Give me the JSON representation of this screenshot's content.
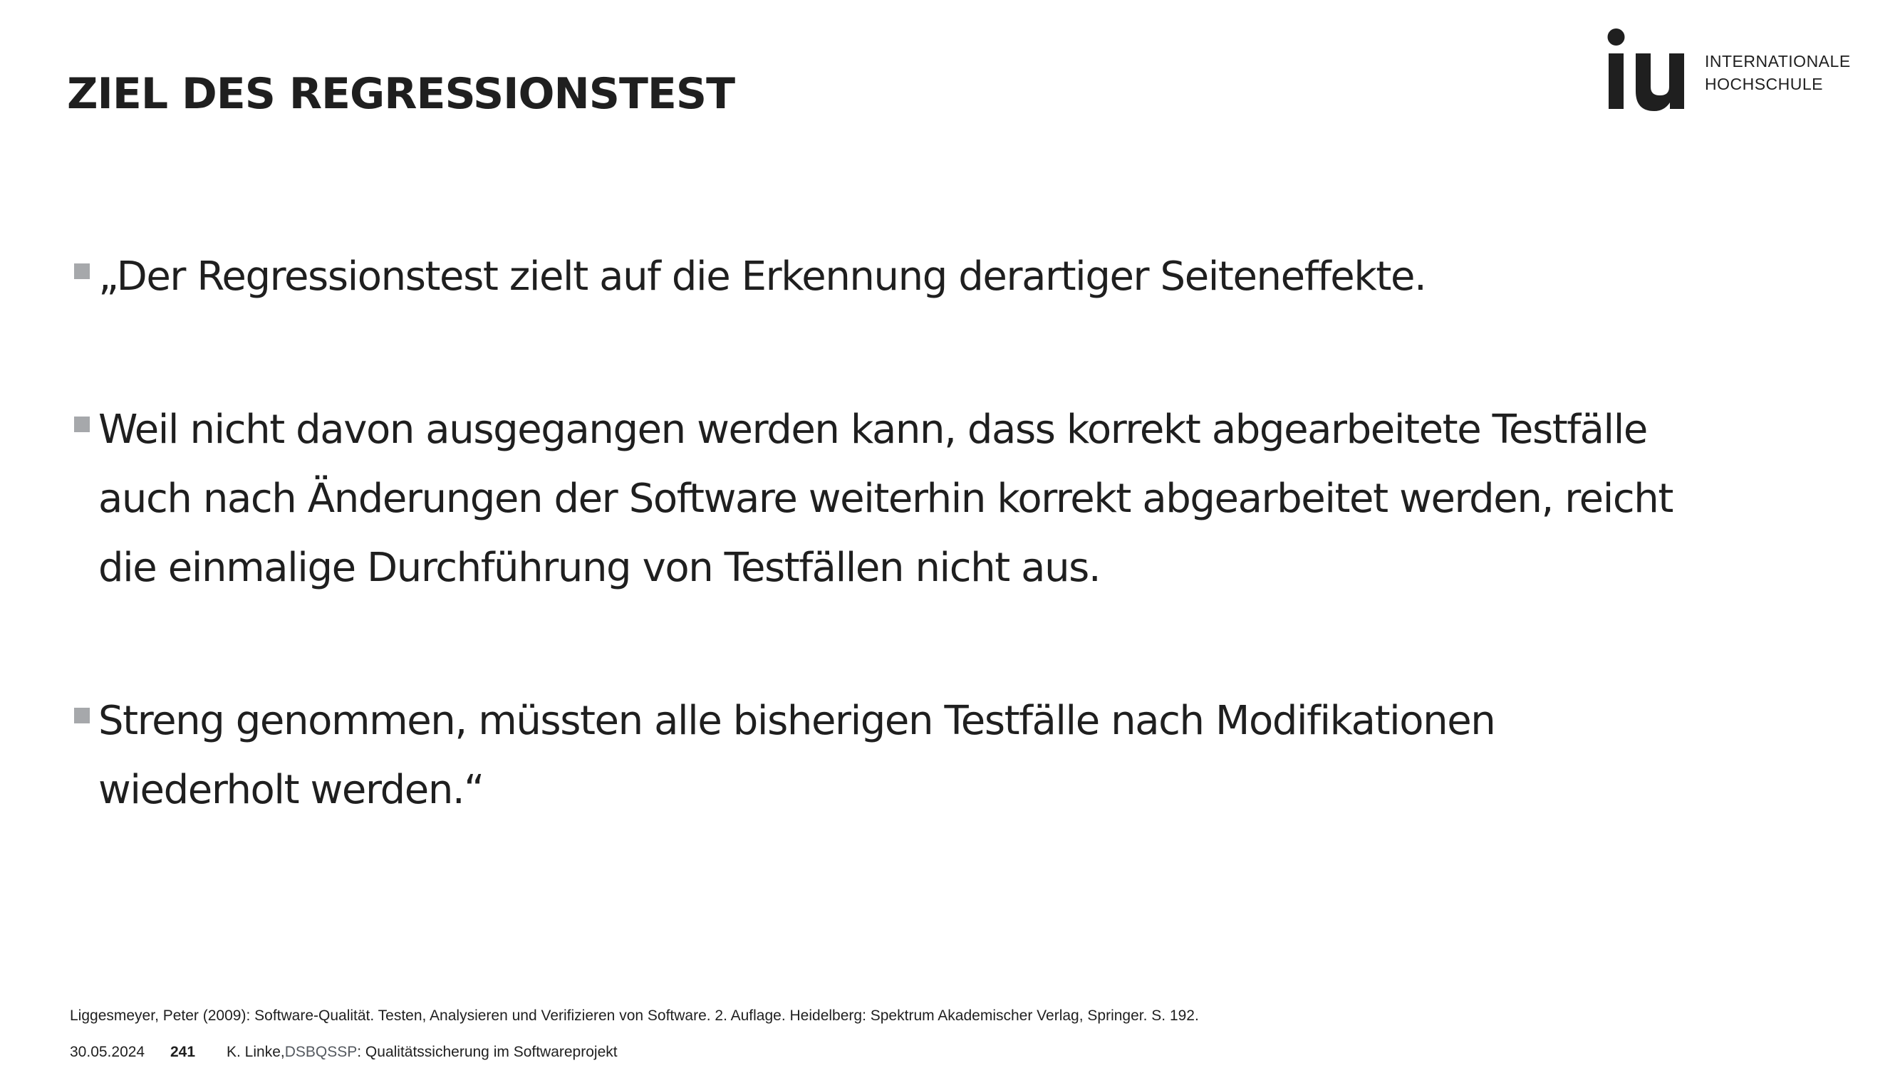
{
  "slide": {
    "title": "ZIEL DES REGRESSIONSTEST"
  },
  "logo": {
    "mark": "iu",
    "line1": "INTERNATIONALE",
    "line2": "HOCHSCHULE",
    "color": "#1f1f1f"
  },
  "bullets": [
    {
      "lines": [
        "„Der Regressionstest zielt auf die Erkennung derartiger Seiteneffekte."
      ],
      "marker_icon": "square-bullet-icon"
    },
    {
      "lines": [
        "Weil nicht davon ausgegangen werden kann, dass korrekt abgearbeitete Testfälle",
        "auch nach Änderungen der Software weiterhin korrekt abgearbeitet werden, reicht",
        "die einmalige Durchführung von Testfällen nicht aus."
      ],
      "marker_icon": "square-bullet-icon"
    },
    {
      "lines": [
        "Streng genommen, müssten alle bisherigen Testfälle nach Modifikationen",
        "wiederholt werden.“"
      ],
      "marker_icon": "square-bullet-icon"
    }
  ],
  "reference": "Liggesmeyer, Peter (2009): Software-Qualität. Testen, Analysieren und Verifizieren von Software. 2. Auflage. Heidelberg: Spektrum Akademischer Verlag, Springer. S. 192.",
  "footer": {
    "date": "30.05.2024",
    "page": "241",
    "author": "K. Linke, ",
    "course_code": "DSBQSSP",
    "course_title": ": Qualitätssicherung im Softwareprojekt"
  },
  "colors": {
    "text": "#1f1f1f",
    "bullet_marker": "#a6a8ab",
    "course_code": "#555a60",
    "background": "#ffffff"
  }
}
